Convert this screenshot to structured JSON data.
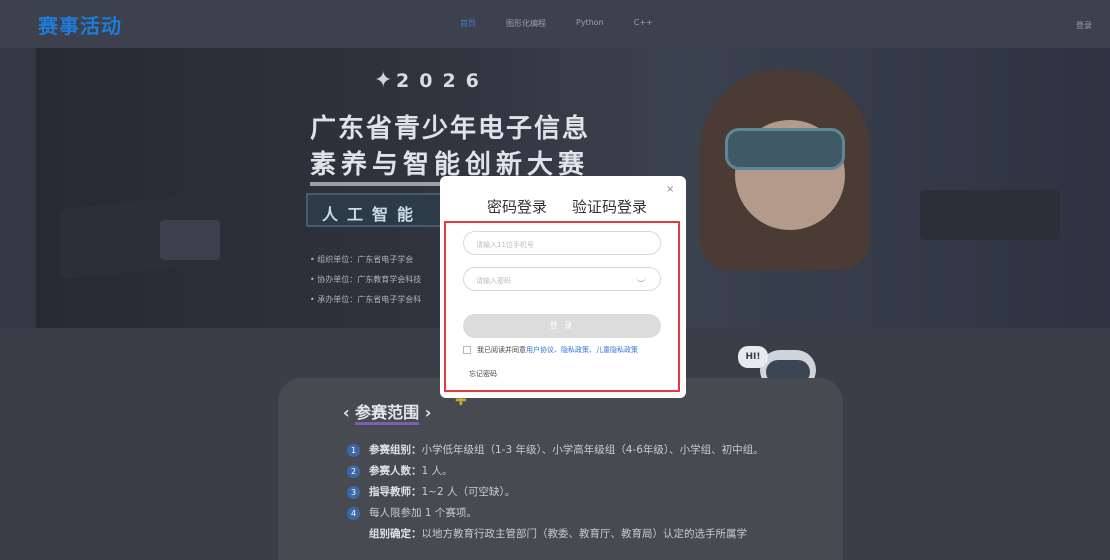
{
  "app": {
    "logo": "赛事活动"
  },
  "nav": {
    "links": [
      "首页",
      "图形化编程",
      "Python",
      "C++"
    ],
    "active": 0,
    "login": "登录"
  },
  "banner": {
    "year": "2026",
    "title_line1": "广东省青少年电子信息",
    "title_line2": "素养与智能创新大赛",
    "track": "人工智能",
    "units": [
      "组织单位：广东省电子学会",
      "协办单位：广东教育学会科技",
      "承办单位：广东省电子学会科"
    ],
    "hi": "HI!"
  },
  "modal": {
    "tab_password": "密码登录",
    "tab_code": "验证码登录",
    "close": "×",
    "phone_placeholder": "请输入11位手机号",
    "password_placeholder": "请输入密码",
    "submit": "登 录",
    "agree_prefix": "我已阅读并同意",
    "agree_links": "用户协议、隐私政策、儿童隐私政策",
    "forgot": "忘记密码"
  },
  "card": {
    "title": "参赛范围",
    "rules": [
      {
        "num": "1",
        "label": "参赛组别：",
        "text": "小学低年级组（1-3 年级）、小学高年级组（4-6年级）、小学组、初中组。"
      },
      {
        "num": "2",
        "label": "参赛人数：",
        "text": "1 人。"
      },
      {
        "num": "3",
        "label": "指导教师：",
        "text": "1~2 人（可空缺）。"
      },
      {
        "num": "4",
        "label": "",
        "text": "每人限参加 1 个赛项。"
      },
      {
        "num": "",
        "label": "组别确定：",
        "text": "以地方教育行政主管部门（教委、教育厅、教育局）认定的选手所属学"
      }
    ]
  },
  "colors": {
    "accent": "#1e7bd8",
    "highlight_frame": "#e23b3b",
    "link": "#2f72d8"
  }
}
